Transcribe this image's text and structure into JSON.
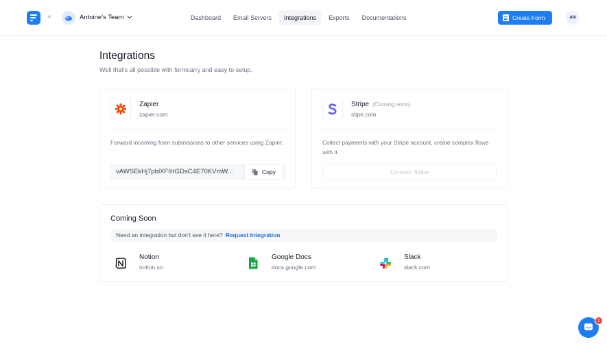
{
  "header": {
    "team_name": "Antoine's Team",
    "nav": [
      {
        "label": "Dashboard",
        "active": false
      },
      {
        "label": "Email Servers",
        "active": false
      },
      {
        "label": "Integrations",
        "active": true
      },
      {
        "label": "Exports",
        "active": false
      },
      {
        "label": "Documentations",
        "active": false
      }
    ],
    "create_label": "Create Form",
    "user_initials": "AN",
    "accent_color": "#1d7df2"
  },
  "page": {
    "title": "Integrations",
    "subtitle": "Well that's all possible with formcarry and easy to setup."
  },
  "zapier": {
    "name": "Zapier",
    "url": "zapier.com",
    "description": "Forward incoming form submissions to other services using Zapier.",
    "api_key": "vAWSEkHj7pblXFIHGDsC4E70KVmW...",
    "copy_label": "Copy",
    "icon": "zapier-asterisk-icon",
    "brand_color": "#ff4a00"
  },
  "stripe": {
    "name": "Stripe",
    "badge": "(Coming soon)",
    "url": "stipe.com",
    "description": "Collect payments with your Stripe account, create complex flows with it.",
    "connect_label": "Connect Stripe",
    "icon": "stripe-s-icon",
    "brand_color": "#635bff"
  },
  "coming_soon": {
    "title": "Coming Soon",
    "request_text": "Need an integration but don't see it here?",
    "request_link": "Request Integration",
    "items": [
      {
        "name": "Notion",
        "url": "notion.so",
        "icon": "notion-icon"
      },
      {
        "name": "Google Docs",
        "url": "docs.google.com",
        "icon": "google-docs-icon"
      },
      {
        "name": "Slack",
        "url": "slack.com",
        "icon": "slack-icon"
      }
    ]
  },
  "chat": {
    "badge_count": "1"
  }
}
